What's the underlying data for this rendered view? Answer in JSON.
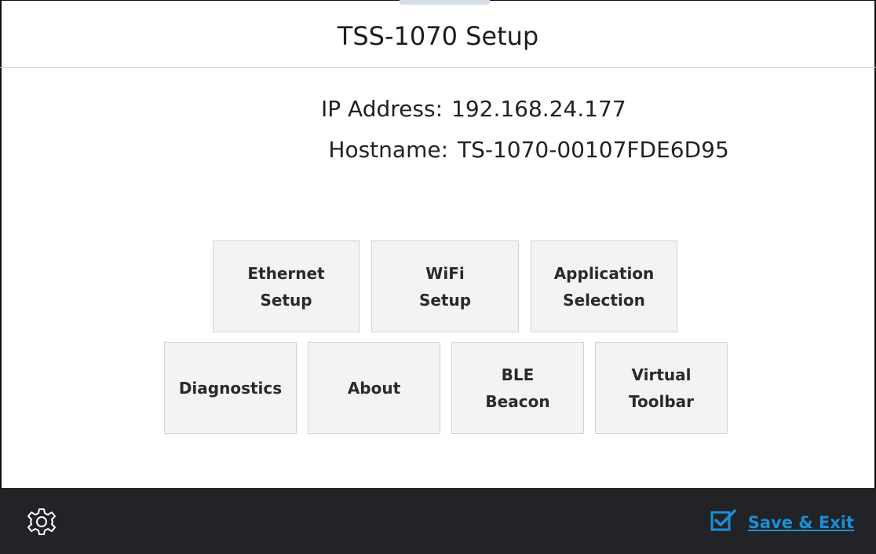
{
  "header": {
    "title": "TSS-1070 Setup"
  },
  "info": {
    "ip_label": "IP Address:",
    "ip_value": "192.168.24.177",
    "hostname_label": "Hostname:",
    "hostname_value": "TS-1070-00107FDE6D95"
  },
  "buttons": {
    "row1": [
      {
        "label": "Ethernet\nSetup"
      },
      {
        "label": "WiFi\nSetup"
      },
      {
        "label": "Application\nSelection"
      }
    ],
    "row2": [
      {
        "label": "Diagnostics"
      },
      {
        "label": "About"
      },
      {
        "label": "BLE\nBeacon"
      },
      {
        "label": "Virtual\nToolbar"
      }
    ]
  },
  "footer": {
    "settings_icon": "gear-icon",
    "save_icon": "checkbox-checked-icon",
    "save_label": "Save & Exit"
  },
  "colors": {
    "footer_bg": "#222326",
    "accent": "#1a8fd6",
    "button_bg": "#f3f3f3"
  }
}
